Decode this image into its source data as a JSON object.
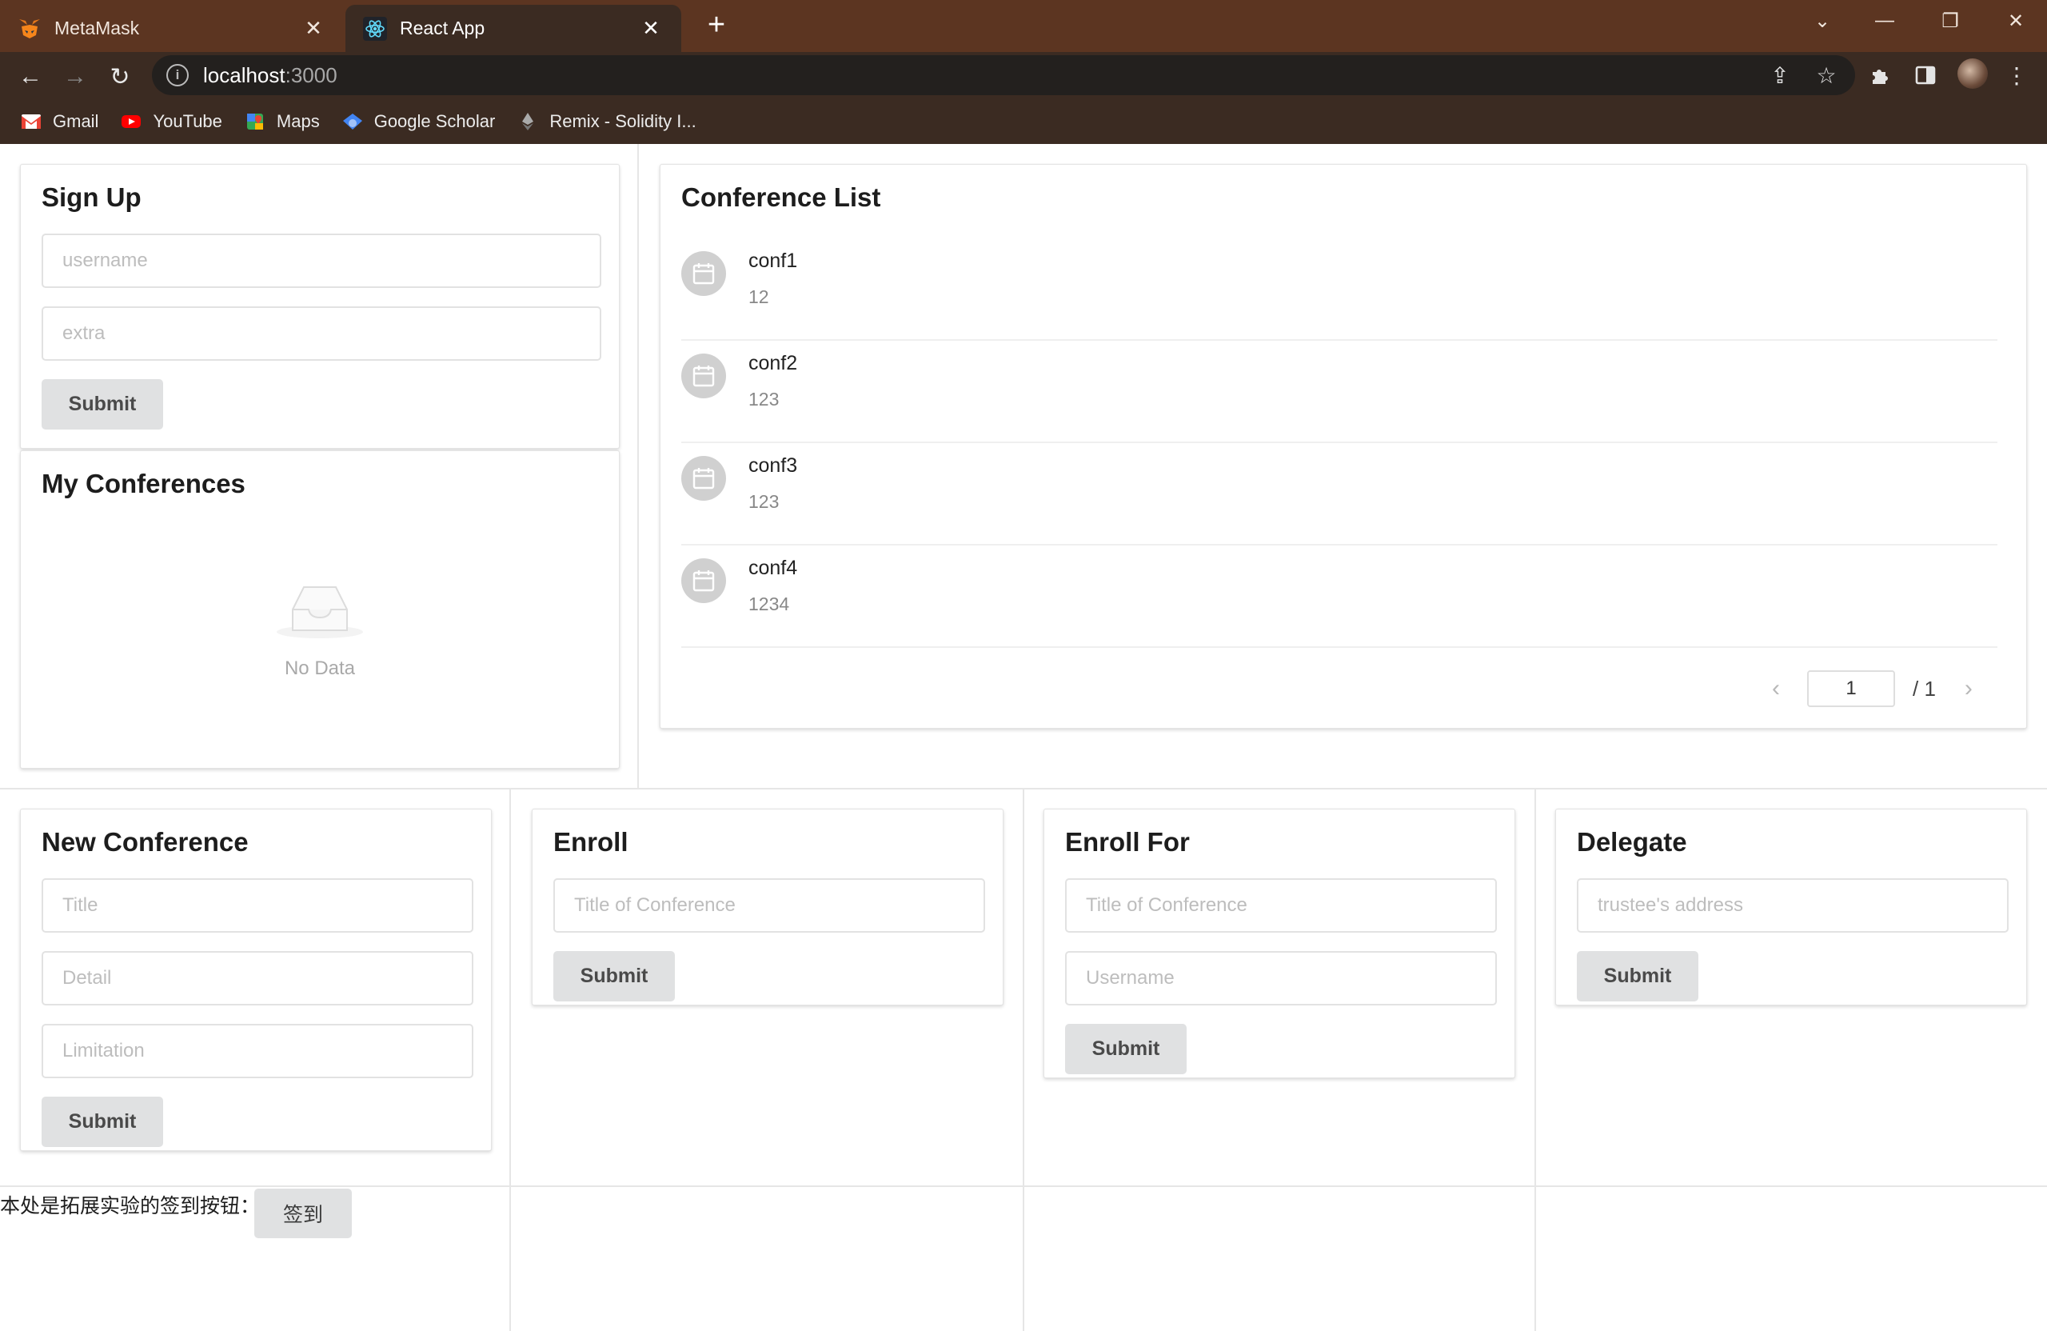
{
  "browser": {
    "tabs": [
      {
        "title": "MetaMask",
        "icon": "metamask-fox-icon"
      },
      {
        "title": "React App",
        "icon": "react-logo-icon",
        "active": true
      }
    ],
    "url_host": "localhost",
    "url_port": ":3000",
    "bookmarks": [
      {
        "label": "Gmail",
        "icon": "gmail-icon"
      },
      {
        "label": "YouTube",
        "icon": "youtube-icon"
      },
      {
        "label": "Maps",
        "icon": "maps-icon"
      },
      {
        "label": "Google Scholar",
        "icon": "scholar-icon"
      },
      {
        "label": "Remix - Solidity I...",
        "icon": "ethereum-icon"
      }
    ],
    "colors": {
      "frame": "#5c3521",
      "toolbar": "#3b2b22"
    }
  },
  "signup": {
    "title": "Sign Up",
    "username_placeholder": "username",
    "extra_placeholder": "extra",
    "submit_label": "Submit"
  },
  "my_conferences": {
    "title": "My Conferences",
    "empty_text": "No Data"
  },
  "conference_list": {
    "title": "Conference List",
    "items": [
      {
        "name": "conf1",
        "detail": "12"
      },
      {
        "name": "conf2",
        "detail": "123"
      },
      {
        "name": "conf3",
        "detail": "123"
      },
      {
        "name": "conf4",
        "detail": "1234"
      }
    ],
    "pagination": {
      "current": "1",
      "total": "/ 1"
    }
  },
  "new_conference": {
    "title": "New Conference",
    "title_placeholder": "Title",
    "detail_placeholder": "Detail",
    "limitation_placeholder": "Limitation",
    "submit_label": "Submit"
  },
  "enroll": {
    "title": "Enroll",
    "conference_placeholder": "Title of Conference",
    "submit_label": "Submit"
  },
  "enroll_for": {
    "title": "Enroll For",
    "conference_placeholder": "Title of Conference",
    "username_placeholder": "Username",
    "submit_label": "Submit"
  },
  "delegate": {
    "title": "Delegate",
    "address_placeholder": "trustee's address",
    "submit_label": "Submit"
  },
  "footer": {
    "text": "本处是拓展实验的签到按钮：",
    "signin_label": "签到"
  }
}
